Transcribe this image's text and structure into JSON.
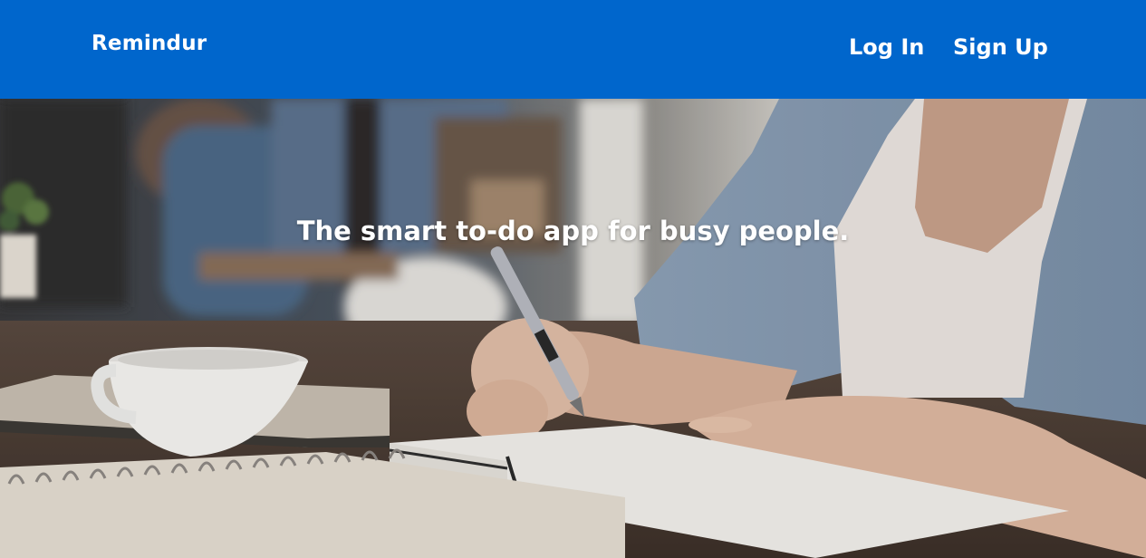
{
  "header": {
    "brand": "Remindur",
    "nav": {
      "login": "Log In",
      "signup": "Sign Up"
    }
  },
  "hero": {
    "tagline": "The smart to-do app for busy people."
  },
  "colors": {
    "nav_background": "#0066cc",
    "nav_text": "#ffffff"
  }
}
